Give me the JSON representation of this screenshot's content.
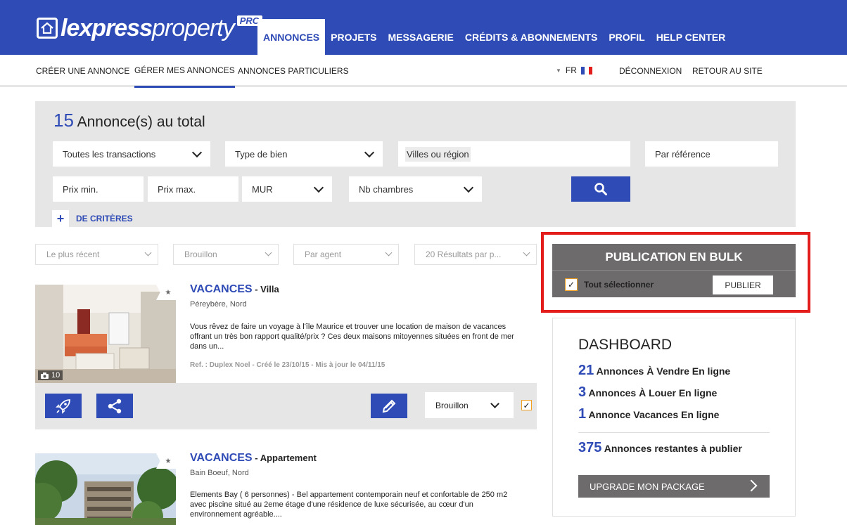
{
  "header": {
    "logo_bold": "lexpress",
    "logo_light": "property",
    "logo_badge": "PRO",
    "nav": [
      {
        "label": "ANNONCES",
        "active": true
      },
      {
        "label": "PROJETS"
      },
      {
        "label": "MESSAGERIE"
      },
      {
        "label": "CRÉDITS & ABONNEMENTS"
      },
      {
        "label": "PROFIL"
      },
      {
        "label": "HELP CENTER"
      }
    ]
  },
  "subnav": {
    "items": [
      {
        "label": "CRÉER UNE ANNONCE"
      },
      {
        "label": "GÉRER MES ANNONCES",
        "active": true
      },
      {
        "label": "ANNONCES PARTICULIERS"
      }
    ],
    "lang": "FR",
    "logout": "DÉCONNEXION",
    "back": "RETOUR AU SITE"
  },
  "search": {
    "count": "15",
    "count_label": "Annonce(s) au total",
    "transactions": "Toutes les transactions",
    "type": "Type de bien",
    "location": "Villes ou région",
    "reference": "Par référence",
    "price_min": "Prix min.",
    "price_max": "Prix max.",
    "currency": "MUR",
    "rooms": "Nb chambres",
    "more_criteria": "DE CRITÈRES"
  },
  "sort": {
    "order": "Le plus récent",
    "status": "Brouillon",
    "agent": "Par agent",
    "per_page": "20 Résultats par p..."
  },
  "listings": [
    {
      "category": "VACANCES",
      "type": "Villa",
      "location": "Péreybère, Nord",
      "description": "Vous rêvez de faire un voyage à l'île Maurice et trouver une location de maison de vacances offrant un très bon rapport qualité/prix ? Ces deux maisons mitoyennes situées en front de mer dans un...",
      "meta": "Ref. : Duplex Noel - Créé le 23/10/15 - Mis à jour le 04/11/15",
      "photos": "10",
      "status": "Brouillon"
    },
    {
      "category": "VACANCES",
      "type": "Appartement",
      "location": "Bain Boeuf, Nord",
      "description": "Elements Bay ( 6 personnes) - Bel appartement contemporain neuf et confortable de 250 m2 avec piscine situé au 2eme étage d'une résidence de luxe sécurisée, au cœur d'un environnement agréable....",
      "meta": "",
      "photos": "",
      "status": ""
    }
  ],
  "bulk": {
    "title": "PUBLICATION EN BULK",
    "select_all": "Tout sélectionner",
    "publish": "PUBLIER"
  },
  "dashboard": {
    "title": "DASHBOARD",
    "sale_n": "21",
    "sale_label": "Annonces À Vendre En ligne",
    "rent_n": "3",
    "rent_label": "Annonces À Louer En ligne",
    "holiday_n": "1",
    "holiday_label": "Annonce Vacances En ligne",
    "remaining_n": "375",
    "remaining_label": "Annonces restantes à publier",
    "upgrade": "UPGRADE MON PACKAGE"
  },
  "colors": {
    "brand_blue": "#2f4bb6",
    "highlight_red": "#e31c1c",
    "panel_grey": "#6d6b6b",
    "checkbox_orange": "#f0a020"
  },
  "icons": [
    "home-logo-icon",
    "search-icon",
    "plus-icon",
    "rocket-icon",
    "share-icon",
    "pencil-icon",
    "camera-icon",
    "star-icon",
    "chevron-down-icon",
    "chevron-right-icon",
    "checkbox-checked-icon"
  ]
}
